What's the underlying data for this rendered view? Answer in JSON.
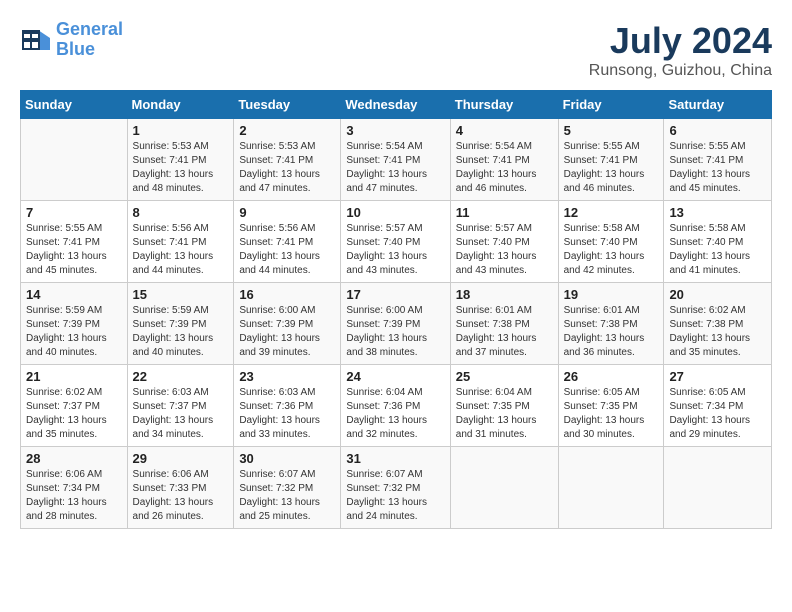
{
  "header": {
    "logo_line1": "General",
    "logo_line2": "Blue",
    "title": "July 2024",
    "subtitle": "Runsong, Guizhou, China"
  },
  "weekdays": [
    "Sunday",
    "Monday",
    "Tuesday",
    "Wednesday",
    "Thursday",
    "Friday",
    "Saturday"
  ],
  "weeks": [
    [
      {
        "day": "",
        "sunrise": "",
        "sunset": "",
        "daylight": ""
      },
      {
        "day": "1",
        "sunrise": "Sunrise: 5:53 AM",
        "sunset": "Sunset: 7:41 PM",
        "daylight": "Daylight: 13 hours and 48 minutes."
      },
      {
        "day": "2",
        "sunrise": "Sunrise: 5:53 AM",
        "sunset": "Sunset: 7:41 PM",
        "daylight": "Daylight: 13 hours and 47 minutes."
      },
      {
        "day": "3",
        "sunrise": "Sunrise: 5:54 AM",
        "sunset": "Sunset: 7:41 PM",
        "daylight": "Daylight: 13 hours and 47 minutes."
      },
      {
        "day": "4",
        "sunrise": "Sunrise: 5:54 AM",
        "sunset": "Sunset: 7:41 PM",
        "daylight": "Daylight: 13 hours and 46 minutes."
      },
      {
        "day": "5",
        "sunrise": "Sunrise: 5:55 AM",
        "sunset": "Sunset: 7:41 PM",
        "daylight": "Daylight: 13 hours and 46 minutes."
      },
      {
        "day": "6",
        "sunrise": "Sunrise: 5:55 AM",
        "sunset": "Sunset: 7:41 PM",
        "daylight": "Daylight: 13 hours and 45 minutes."
      }
    ],
    [
      {
        "day": "7",
        "sunrise": "Sunrise: 5:55 AM",
        "sunset": "Sunset: 7:41 PM",
        "daylight": "Daylight: 13 hours and 45 minutes."
      },
      {
        "day": "8",
        "sunrise": "Sunrise: 5:56 AM",
        "sunset": "Sunset: 7:41 PM",
        "daylight": "Daylight: 13 hours and 44 minutes."
      },
      {
        "day": "9",
        "sunrise": "Sunrise: 5:56 AM",
        "sunset": "Sunset: 7:41 PM",
        "daylight": "Daylight: 13 hours and 44 minutes."
      },
      {
        "day": "10",
        "sunrise": "Sunrise: 5:57 AM",
        "sunset": "Sunset: 7:40 PM",
        "daylight": "Daylight: 13 hours and 43 minutes."
      },
      {
        "day": "11",
        "sunrise": "Sunrise: 5:57 AM",
        "sunset": "Sunset: 7:40 PM",
        "daylight": "Daylight: 13 hours and 43 minutes."
      },
      {
        "day": "12",
        "sunrise": "Sunrise: 5:58 AM",
        "sunset": "Sunset: 7:40 PM",
        "daylight": "Daylight: 13 hours and 42 minutes."
      },
      {
        "day": "13",
        "sunrise": "Sunrise: 5:58 AM",
        "sunset": "Sunset: 7:40 PM",
        "daylight": "Daylight: 13 hours and 41 minutes."
      }
    ],
    [
      {
        "day": "14",
        "sunrise": "Sunrise: 5:59 AM",
        "sunset": "Sunset: 7:39 PM",
        "daylight": "Daylight: 13 hours and 40 minutes."
      },
      {
        "day": "15",
        "sunrise": "Sunrise: 5:59 AM",
        "sunset": "Sunset: 7:39 PM",
        "daylight": "Daylight: 13 hours and 40 minutes."
      },
      {
        "day": "16",
        "sunrise": "Sunrise: 6:00 AM",
        "sunset": "Sunset: 7:39 PM",
        "daylight": "Daylight: 13 hours and 39 minutes."
      },
      {
        "day": "17",
        "sunrise": "Sunrise: 6:00 AM",
        "sunset": "Sunset: 7:39 PM",
        "daylight": "Daylight: 13 hours and 38 minutes."
      },
      {
        "day": "18",
        "sunrise": "Sunrise: 6:01 AM",
        "sunset": "Sunset: 7:38 PM",
        "daylight": "Daylight: 13 hours and 37 minutes."
      },
      {
        "day": "19",
        "sunrise": "Sunrise: 6:01 AM",
        "sunset": "Sunset: 7:38 PM",
        "daylight": "Daylight: 13 hours and 36 minutes."
      },
      {
        "day": "20",
        "sunrise": "Sunrise: 6:02 AM",
        "sunset": "Sunset: 7:38 PM",
        "daylight": "Daylight: 13 hours and 35 minutes."
      }
    ],
    [
      {
        "day": "21",
        "sunrise": "Sunrise: 6:02 AM",
        "sunset": "Sunset: 7:37 PM",
        "daylight": "Daylight: 13 hours and 35 minutes."
      },
      {
        "day": "22",
        "sunrise": "Sunrise: 6:03 AM",
        "sunset": "Sunset: 7:37 PM",
        "daylight": "Daylight: 13 hours and 34 minutes."
      },
      {
        "day": "23",
        "sunrise": "Sunrise: 6:03 AM",
        "sunset": "Sunset: 7:36 PM",
        "daylight": "Daylight: 13 hours and 33 minutes."
      },
      {
        "day": "24",
        "sunrise": "Sunrise: 6:04 AM",
        "sunset": "Sunset: 7:36 PM",
        "daylight": "Daylight: 13 hours and 32 minutes."
      },
      {
        "day": "25",
        "sunrise": "Sunrise: 6:04 AM",
        "sunset": "Sunset: 7:35 PM",
        "daylight": "Daylight: 13 hours and 31 minutes."
      },
      {
        "day": "26",
        "sunrise": "Sunrise: 6:05 AM",
        "sunset": "Sunset: 7:35 PM",
        "daylight": "Daylight: 13 hours and 30 minutes."
      },
      {
        "day": "27",
        "sunrise": "Sunrise: 6:05 AM",
        "sunset": "Sunset: 7:34 PM",
        "daylight": "Daylight: 13 hours and 29 minutes."
      }
    ],
    [
      {
        "day": "28",
        "sunrise": "Sunrise: 6:06 AM",
        "sunset": "Sunset: 7:34 PM",
        "daylight": "Daylight: 13 hours and 28 minutes."
      },
      {
        "day": "29",
        "sunrise": "Sunrise: 6:06 AM",
        "sunset": "Sunset: 7:33 PM",
        "daylight": "Daylight: 13 hours and 26 minutes."
      },
      {
        "day": "30",
        "sunrise": "Sunrise: 6:07 AM",
        "sunset": "Sunset: 7:32 PM",
        "daylight": "Daylight: 13 hours and 25 minutes."
      },
      {
        "day": "31",
        "sunrise": "Sunrise: 6:07 AM",
        "sunset": "Sunset: 7:32 PM",
        "daylight": "Daylight: 13 hours and 24 minutes."
      },
      {
        "day": "",
        "sunrise": "",
        "sunset": "",
        "daylight": ""
      },
      {
        "day": "",
        "sunrise": "",
        "sunset": "",
        "daylight": ""
      },
      {
        "day": "",
        "sunrise": "",
        "sunset": "",
        "daylight": ""
      }
    ]
  ]
}
